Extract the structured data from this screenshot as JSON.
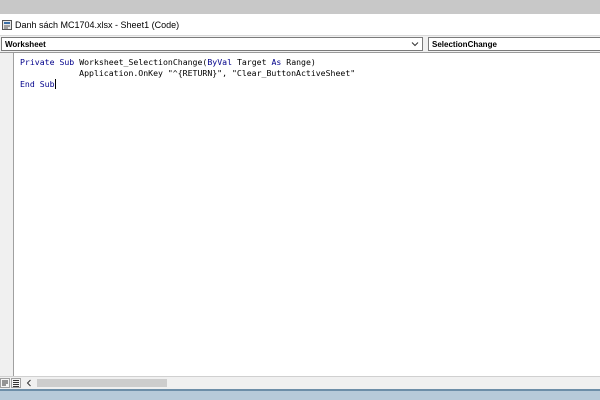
{
  "window": {
    "title": "Danh sách MC1704.xlsx - Sheet1 (Code)",
    "icon": "vba-module-icon"
  },
  "object_dropdown": {
    "value": "Worksheet",
    "icon": "chevron-down-icon"
  },
  "procedure_dropdown": {
    "value": "SelectionChange"
  },
  "code": {
    "line1": {
      "kw1": "Private",
      "kw2": "Sub",
      "t1": "Worksheet_SelectionChange(",
      "kw3": "ByVal",
      "t2": "Target",
      "kw4": "As",
      "t3": "Range)"
    },
    "line2": "            Application.OnKey \"^{RETURN}\", \"Clear_ButtonActiveSheet\"",
    "line3": {
      "kw1": "End",
      "kw2": "Sub"
    }
  },
  "colors": {
    "keyword": "#00008b",
    "text": "#000000",
    "background": "#ffffff"
  },
  "bottom": {
    "scroll_left_icon": "chevron-left-icon",
    "procedure_view_icon": "procedure-view-icon",
    "full_module_view_icon": "full-module-view-icon"
  }
}
